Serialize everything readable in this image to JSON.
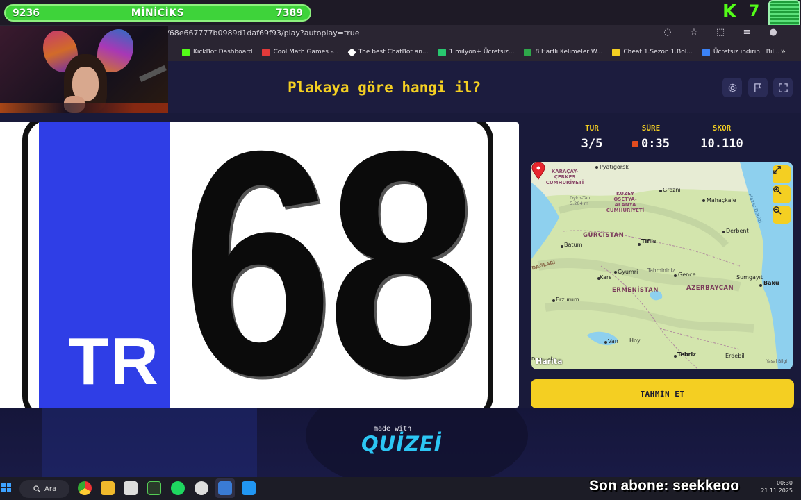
{
  "overlay": {
    "goal_left": "9236",
    "goal_title": "MİNİCİKS",
    "goal_right": "7389",
    "brand_k": "K",
    "brand_num": "7",
    "subscriber": "Son abone: seekkeoo"
  },
  "browser": {
    "url": "/68e667777b0989d1daf69f93/play?autoplay=true",
    "bookmarks": [
      {
        "label": "KickBot Dashboard",
        "color": "#53fc18"
      },
      {
        "label": "Cool Math Games -...",
        "color": "#e23a3a"
      },
      {
        "label": "The best ChatBot an...",
        "color": "#ffffff"
      },
      {
        "label": "1 milyon+ Ücretsiz...",
        "color": "#28c76f"
      },
      {
        "label": "8 Harfli Kelimeler W...",
        "color": "#2ea84a"
      },
      {
        "label": "Cheat 1.Sezon 1.Böl...",
        "color": "#f4cf22"
      },
      {
        "label": "Ücretsiz indirin | Bil...",
        "color": "#3b82f6"
      }
    ]
  },
  "quiz": {
    "question": "Plakaya göre hangi il?",
    "plate_country": "TR",
    "plate_number": "68",
    "stats": {
      "round_label": "TUR",
      "round_value": "3/5",
      "time_label": "SÜRE",
      "time_value": "0:35",
      "score_label": "SKOR",
      "score_value": "10.110"
    },
    "guess_button": "TAHMİN ET",
    "made_with": "made with",
    "brand": "QUİZEİ"
  },
  "map": {
    "labels": {
      "pyatigorsk": "Pyatigorsk",
      "karacay": "KARAÇAY-\nÇERKES\nCUMHURİYETİ",
      "kuzey": "KUZEY\nOSETYA-\nALANYA\nCUMHURİYETİ",
      "grozni": "Grozni",
      "mahackale": "Mahaçkale",
      "dykh": "Dykh-Tau\n5.204 m",
      "gurcistan": "GÜRCİSTAN",
      "tiflis": "Tiflis",
      "derbent": "Derbent",
      "batum": "Batum",
      "tahmininiz": "Tahmininiz",
      "gyumri": "Gyumri",
      "kars": "Kars",
      "gence": "Gence",
      "sumgayit": "Sumgayıt",
      "baku": "Bakü",
      "ermenistan": "ERMENİSTAN",
      "azerbaycan": "AZERBAYCAN",
      "erzurum": "Erzurum",
      "van": "Van",
      "hoy": "Hoy",
      "tebriz": "Tebriz",
      "erdebil": "Erdebil",
      "diyarbakir": "Diyarbakır",
      "daglari": "DAĞLARI",
      "hazar": "Hazar Denizi"
    },
    "attribution": "Harita",
    "terms": "Yasal Bilgi"
  },
  "taskbar": {
    "search_label": "Ara",
    "time": "00:30",
    "date": "21.11.2025"
  }
}
